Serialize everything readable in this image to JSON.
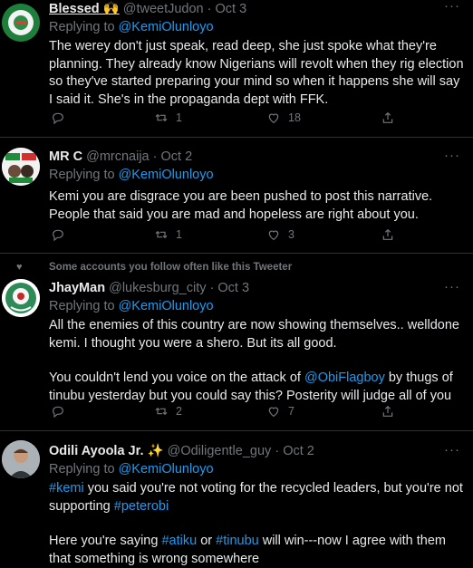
{
  "tweets": [
    {
      "name": "Blessed 🙌",
      "handle": "@tweetJudon",
      "date": "Oct 3",
      "replying_prefix": "Replying to",
      "replying_to": "@KemiOlunloyo",
      "text": "The werey don't just speak, read deep, she just spoke what they're planning. They already know Nigerians will revolt when they rig election so they've started preparing your mind so when it happens she will say I said it. She's in the propaganda dept with FFK.",
      "retweets": "1",
      "likes": "18"
    },
    {
      "name": "MR C",
      "handle": "@mrcnaija",
      "date": "Oct 2",
      "replying_prefix": "Replying to",
      "replying_to": "@KemiOlunloyo",
      "text": "Kemi you are disgrace you are been pushed to post this narrative. People that said you are mad and hopeless are right about you.",
      "retweets": "1",
      "likes": "3"
    },
    {
      "social_context": "Some accounts you follow often like this Tweeter",
      "name": "JhayMan",
      "handle": "@lukesburg_city",
      "date": "Oct 3",
      "replying_prefix": "Replying to",
      "replying_to": "@KemiOlunloyo",
      "text1": "All the enemies of this country are now showing themselves.. welldone kemi. I thought you were a shero. But its all good.",
      "text2_a": "You couldn't lend you voice on the attack of",
      "text2_mention": "@ObiFlagboy",
      "text2_b": " by thugs of tinubu yesterday but you could say this? Posterity will judge all of you",
      "retweets": "2",
      "likes": "7"
    },
    {
      "name": "Odili Ayoola Jr. ✨",
      "handle": "@Odiligentle_guy",
      "date": "Oct 2",
      "replying_prefix": "Replying to",
      "replying_to": "@KemiOlunloyo",
      "tag1": "#kemi",
      "text_a": " you said you're not voting for the recycled leaders, but you're not supporting ",
      "tag2": "#peterobi",
      "text_b": "Here you're saying ",
      "tag3": "#atiku",
      "text_c": " or ",
      "tag4": "#tinubu",
      "text_d": " will win---now I agree with them that something is wrong somewhere"
    }
  ],
  "icons": {
    "reply": "reply-icon",
    "retweet": "retweet-icon",
    "like": "heart-icon",
    "share": "share-icon",
    "more": "more-icon"
  },
  "colors": {
    "background": "#000000",
    "text": "#e7e9ea",
    "muted": "#71767b",
    "link": "#1d9bf0",
    "divider": "#2f3336"
  }
}
